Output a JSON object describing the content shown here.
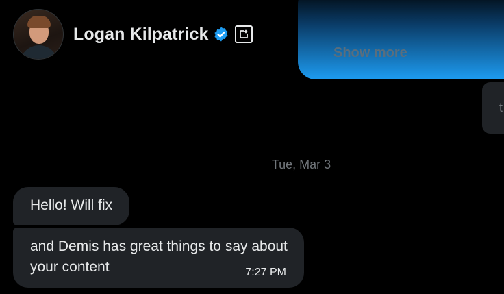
{
  "header": {
    "name": "Logan Kilpatrick",
    "verified_icon": "verified-badge-icon",
    "external_icon": "open-external-icon"
  },
  "outgoing": {
    "show_more": "Show more",
    "side_letter": "t"
  },
  "date_divider": "Tue, Mar 3",
  "messages": [
    {
      "text": "Hello! Will fix"
    },
    {
      "text": "and Demis has great things to say about your content",
      "time": "7:27 PM"
    }
  ],
  "colors": {
    "background": "#000000",
    "bubble": "#202327",
    "text": "#e7e9ea",
    "muted": "#71767b",
    "accent": "#1d9bf0"
  }
}
